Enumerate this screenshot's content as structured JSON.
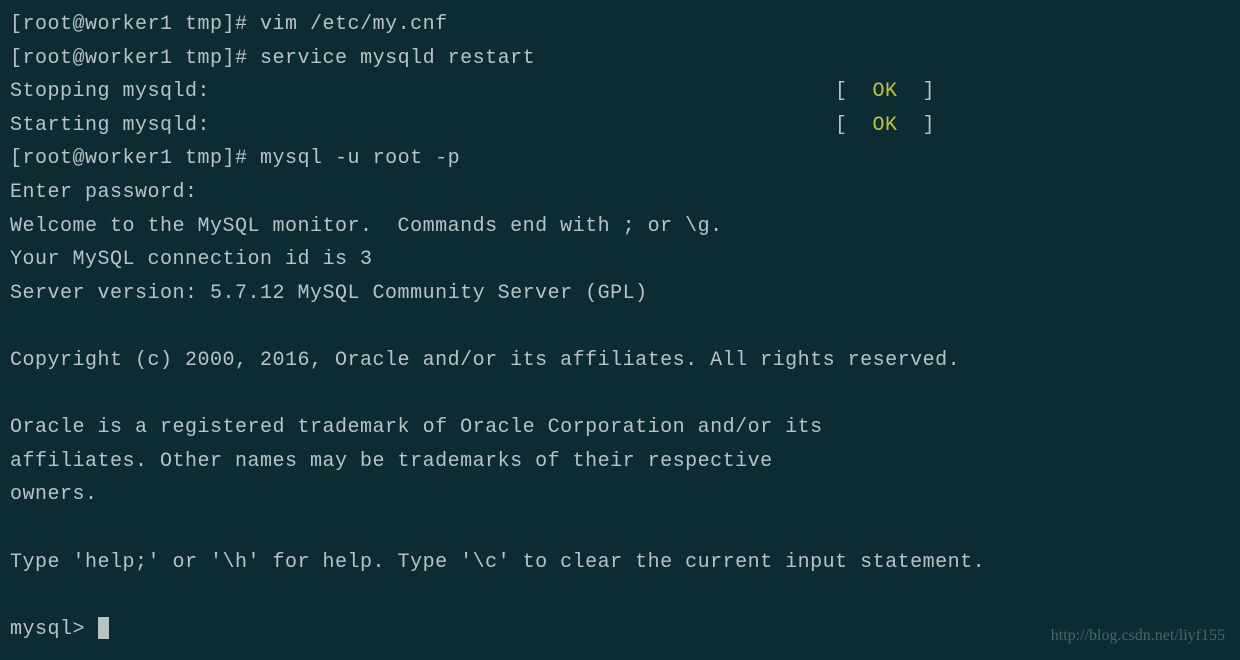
{
  "lines": {
    "l1_prompt": "[root@worker1 tmp]# ",
    "l1_cmd": "vim /etc/my.cnf",
    "l2_prompt": "[root@worker1 tmp]# ",
    "l2_cmd": "service mysqld restart",
    "l3_left": "Stopping mysqld:",
    "l3_bl": "[  ",
    "l3_ok": "OK",
    "l3_br": "  ]",
    "l4_left": "Starting mysqld:",
    "l4_bl": "[  ",
    "l4_ok": "OK",
    "l4_br": "  ]",
    "l5_prompt": "[root@worker1 tmp]# ",
    "l5_cmd": "mysql -u root -p",
    "l6": "Enter password:",
    "l7": "Welcome to the MySQL monitor.  Commands end with ; or \\g.",
    "l8": "Your MySQL connection id is 3",
    "l9": "Server version: 5.7.12 MySQL Community Server (GPL)",
    "l10": "",
    "l11": "Copyright (c) 2000, 2016, Oracle and/or its affiliates. All rights reserved.",
    "l12": "",
    "l13": "Oracle is a registered trademark of Oracle Corporation and/or its",
    "l14": "affiliates. Other names may be trademarks of their respective",
    "l15": "owners.",
    "l16": "",
    "l17": "Type 'help;' or '\\h' for help. Type '\\c' to clear the current input statement.",
    "l18": "",
    "l19_prompt": "mysql> "
  },
  "watermark": "http://blog.csdn.net/liyf155"
}
